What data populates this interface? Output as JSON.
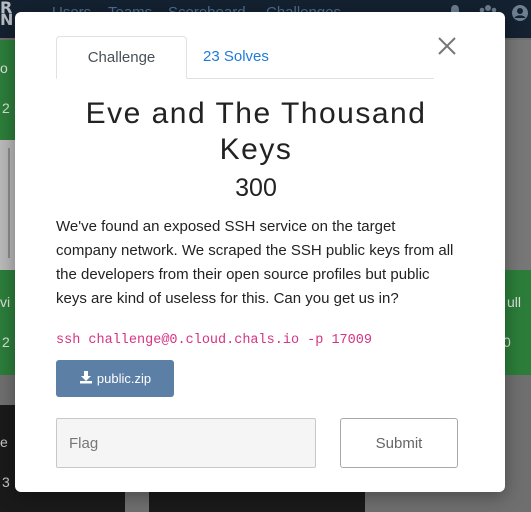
{
  "navbar": {
    "brand_line1": "R",
    "brand_line2": "N",
    "links": [
      "Users",
      "Teams",
      "Scoreboard",
      "Challenges"
    ],
    "icons": [
      "bell-icon",
      "team-icon",
      "user-icon"
    ]
  },
  "background_tiles": {
    "left_top_snippet": "o",
    "left_top_value": "2",
    "left_mid_snippet": "vi",
    "left_mid_value": "2",
    "right_mid_snippet": "ull",
    "right_mid_value": "0",
    "left_bottom_snippet": "e",
    "left_bottom_value": "3"
  },
  "modal": {
    "tabs": [
      {
        "label": "Challenge",
        "active": true
      },
      {
        "label": "23 Solves",
        "active": false
      }
    ],
    "close_icon": "close-icon",
    "title": "Eve and The Thousand Keys",
    "value": "300",
    "description": "We've found an exposed SSH service on the target company network. We scraped the SSH public keys from all the developers from their open source profiles but public keys are kind of useless for this. Can you get us in?",
    "command": "ssh challenge@0.cloud.chals.io -p 17009",
    "file": {
      "icon": "download-icon",
      "label": "public.zip"
    },
    "flag_input": {
      "placeholder": "Flag",
      "value": ""
    },
    "submit_label": "Submit",
    "colors": {
      "accent": "#1f7bd8",
      "file_button": "#5c7fa6",
      "command": "#d63384"
    }
  }
}
